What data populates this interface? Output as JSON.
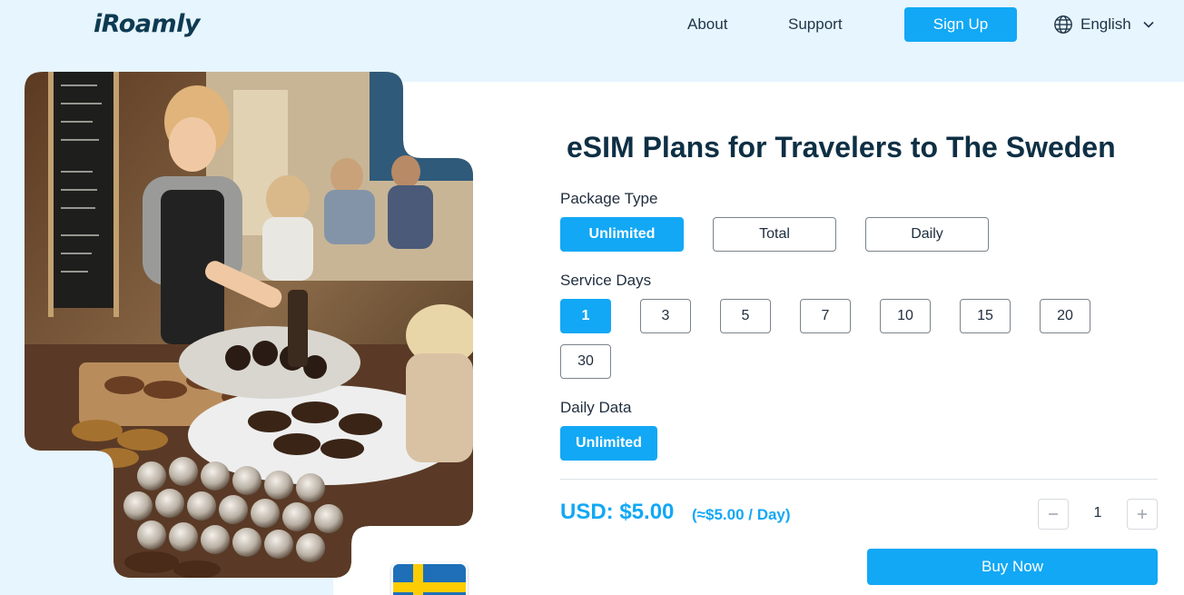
{
  "header": {
    "logo": "iRoamly",
    "nav": {
      "about": "About",
      "support": "Support"
    },
    "signup_label": "Sign Up",
    "language": {
      "label": "English",
      "icon": "globe-icon"
    }
  },
  "hero": {
    "image": "sweden-market-photo",
    "flag": "sweden-flag"
  },
  "plan": {
    "title": "eSIM Plans for Travelers to The Sweden",
    "package_type": {
      "label": "Package Type",
      "options": [
        "Unlimited",
        "Total",
        "Daily"
      ],
      "selected": "Unlimited"
    },
    "service_days": {
      "label": "Service Days",
      "options": [
        "1",
        "3",
        "5",
        "7",
        "10",
        "15",
        "20",
        "30"
      ],
      "selected": "1"
    },
    "daily_data": {
      "label": "Daily Data",
      "options": [
        "Unlimited"
      ],
      "selected": "Unlimited"
    },
    "price": "USD: $5.00",
    "price_per_day": "(≈$5.00 / Day)",
    "quantity": "1",
    "buy_label": "Buy Now"
  },
  "colors": {
    "accent": "#12a8f5",
    "page_bg": "#e6f5fe",
    "title": "#0e2f44"
  }
}
